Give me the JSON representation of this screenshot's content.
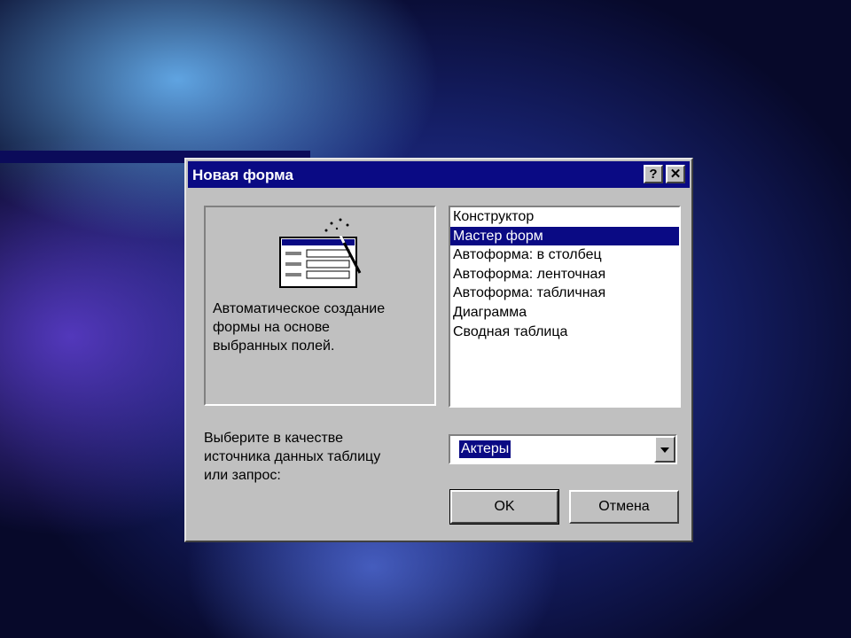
{
  "dialog": {
    "title": "Новая форма",
    "help_label": "?",
    "close_label": "✕",
    "description": "Автоматическое создание\nформы на основе\nвыбранных полей.",
    "list_items": [
      "Конструктор",
      "Мастер форм",
      "Автоформа: в столбец",
      "Автоформа: ленточная",
      "Автоформа: табличная",
      "Диаграмма",
      "Сводная таблица"
    ],
    "selected_item": "Мастер форм",
    "source_label": "Выберите в качестве\nисточника данных таблицу\nили запрос:",
    "source_value": "Актеры",
    "ok_label": "OK",
    "cancel_label": "Отмена"
  },
  "icons": [
    "wizard-form-icon",
    "dropdown-arrow-icon",
    "help-icon",
    "close-icon"
  ],
  "colors": {
    "titlebar": "#0a0a84",
    "selection": "#0a0a84",
    "dialog_face": "#c0c0c0"
  }
}
